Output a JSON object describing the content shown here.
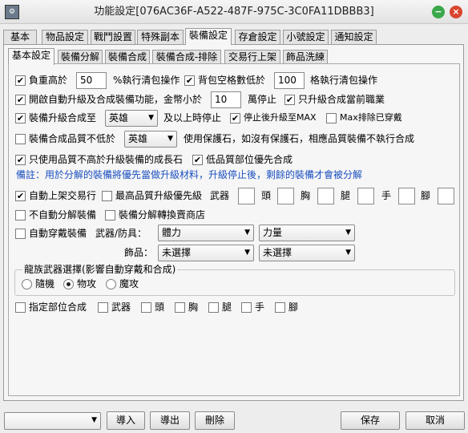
{
  "window": {
    "title": "功能設定[076AC36F-A522-487F-975C-3C0FA11DBBB3]",
    "icon": "app-icon",
    "accent_min": "#3aa84a",
    "accent_close": "#d9442e"
  },
  "top_tabs": [
    "基本",
    "物品設定",
    "戰鬥設置",
    "特殊副本",
    "裝備設定",
    "存倉設定",
    "小號設定",
    "通知設定"
  ],
  "sub_tabs": [
    "基本設定",
    "裝備分解",
    "裝備合成",
    "裝備合成-排除",
    "交易行上架",
    "飾品洗練"
  ],
  "form": {
    "r1": {
      "a": "負重高於",
      "a_val": "50",
      "b": "%執行清包操作",
      "c": "背包空格數低於",
      "c_val": "100",
      "d": "格執行清包操作"
    },
    "r2": {
      "a": "開啟自動升級及合成裝備功能，金幣小於",
      "a_val": "10",
      "b": "萬停止",
      "c": "只升級合成當前職業"
    },
    "r3": {
      "a": "裝備升級合成至",
      "dd": "英雄",
      "b": "及以上時停止",
      "c": "停止後升級至MAX",
      "d": "Max排除已穿戴"
    },
    "r4": {
      "a": "裝備合成品質不低於",
      "dd": "英雄",
      "b": "使用保護石，如沒有保護石，相應品質裝備不執行合成"
    },
    "r5": {
      "a": "只使用品質不高於升級裝備的成長石",
      "b": "低品質部位優先合成"
    },
    "note": "備註：用於分解的裝備將優先當做升級材料，升級停止後，剩餘的裝備才會被分解",
    "r6": {
      "a": "自動上架交易行",
      "b": "最高品質升級優先級",
      "weapon": "武器",
      "head": "頭",
      "chest": "胸",
      "leg": "腿",
      "hand": "手",
      "foot": "腳"
    },
    "r7": {
      "a": "不自動分解裝備",
      "b": "裝備分解轉換賣商店"
    },
    "r8": {
      "a": "自動穿戴裝備",
      "b": "武器/防具：",
      "dd1": "體力",
      "dd2": "力量"
    },
    "r9": {
      "b": "飾品：",
      "dd1": "未選擇",
      "dd2": "未選擇"
    },
    "group": {
      "title": "龍族武器選擇(影響自動穿戴和合成)",
      "opt1": "隨機",
      "opt2": "物攻",
      "opt3": "魔攻"
    },
    "r10": {
      "a": "指定部位合成",
      "weapon": "武器",
      "head": "頭",
      "chest": "胸",
      "leg": "腿",
      "hand": "手",
      "foot": "腳"
    }
  },
  "footer": {
    "import": "導入",
    "export": "導出",
    "delete": "刪除",
    "save": "保存",
    "cancel": "取消"
  }
}
